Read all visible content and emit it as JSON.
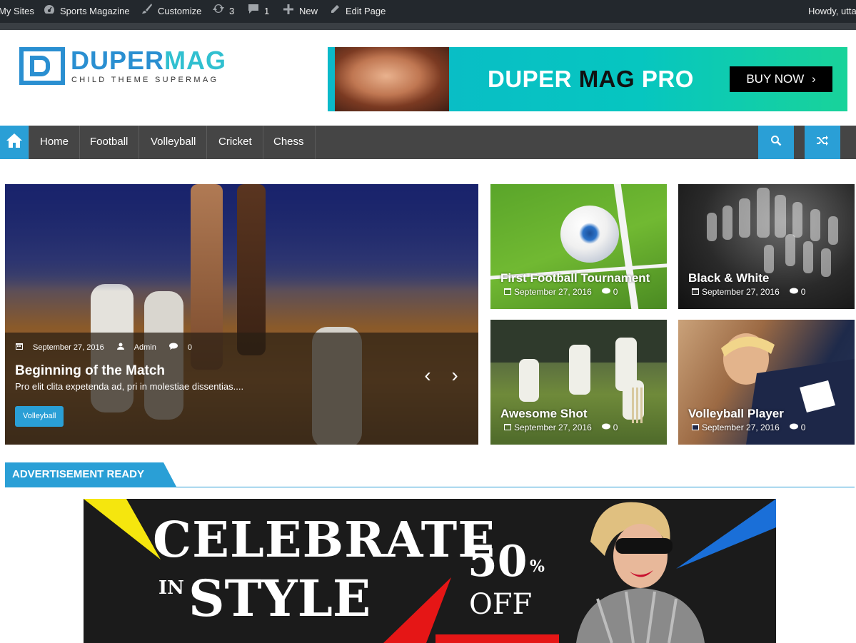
{
  "adminbar": {
    "my_sites": "My Sites",
    "site_name": "Sports Magazine",
    "customize": "Customize",
    "updates_count": "3",
    "comments_count": "1",
    "new": "New",
    "edit_page": "Edit Page",
    "howdy": "Howdy, utta"
  },
  "header": {
    "logo_part1": "DUPER",
    "logo_part2": "MAG",
    "tagline": "CHILD THEME SUPERMAG",
    "banner": {
      "title_part1": "DUPER ",
      "title_part2": "MAG",
      "title_part3": " PRO",
      "cta": "BUY NOW"
    }
  },
  "nav": {
    "items": [
      "Home",
      "Football",
      "Volleyball",
      "Cricket",
      "Chess"
    ]
  },
  "slider": {
    "date": "September 27, 2016",
    "author": "Admin",
    "comments": "0",
    "title": "Beginning of the Match",
    "excerpt": "Pro elit clita expetenda ad, pri in molestiae dissentias....",
    "category": "Volleyball"
  },
  "thumbs": [
    {
      "title": "First Football Tournament",
      "date": "September 27, 2016",
      "comments": "0"
    },
    {
      "title": "Black & White",
      "date": "September 27, 2016",
      "comments": "0"
    },
    {
      "title": "Awesome Shot",
      "date": "September 27, 2016",
      "comments": "0"
    },
    {
      "title": "Volleyball Player",
      "date": "September 27, 2016",
      "comments": "0"
    }
  ],
  "section": {
    "title": "ADVERTISEMENT READY"
  },
  "ad": {
    "celebrate": "CELEBRATE",
    "in": "IN",
    "style": "STYLE",
    "discount": "50",
    "percent": "%",
    "off": "OFF"
  },
  "colors": {
    "accent": "#2a9fd6",
    "nav_bg": "#454545",
    "adminbar_bg": "#23282d",
    "banner_start": "#0bb9c9",
    "banner_end": "#19d39a"
  },
  "icons": {
    "home": "home-icon",
    "search": "search-icon",
    "random": "random-icon",
    "calendar": "calendar-icon",
    "user": "user-icon",
    "comment": "comment-icon",
    "chevron_left": "chevron-left-icon",
    "chevron_right": "chevron-right-icon"
  }
}
